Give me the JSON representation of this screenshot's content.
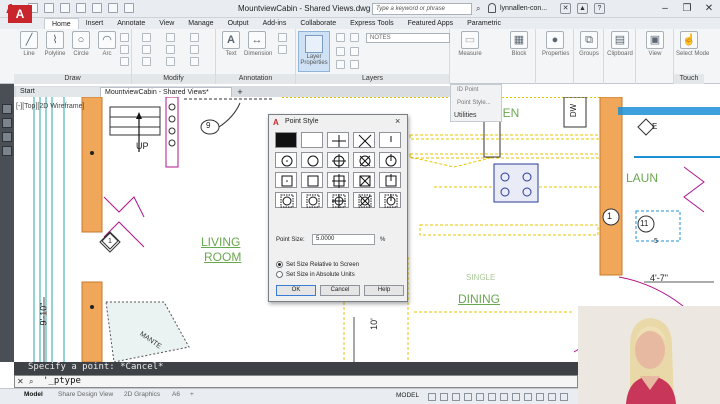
{
  "window": {
    "title": "MountviewCabin - Shared Views.dwg",
    "search_placeholder": "Type a keyword or phrase",
    "username": "lynnallen-con..."
  },
  "app_button": "A",
  "ribbon_tabs": [
    "Home",
    "Insert",
    "Annotate",
    "View",
    "Manage",
    "Output",
    "Add-ins",
    "Collaborate",
    "Express Tools",
    "Featured Apps",
    "Parametric"
  ],
  "ribbon": {
    "draw": {
      "title": "Draw",
      "buttons": [
        "Line",
        "Polyline",
        "Circle",
        "Arc"
      ]
    },
    "modify": {
      "title": "Modify"
    },
    "annotation": {
      "title": "Annotation",
      "buttons": [
        "Text",
        "Dimension"
      ]
    },
    "layers": {
      "title": "Layers",
      "properties_label": "Layer Properties",
      "layer_dropdown": "NOTES"
    },
    "measure_label": "Measure",
    "block_label": "Block",
    "properties_label": "Properties",
    "groups_label": "Groups",
    "clipboard_label": "Clipboard",
    "view_label": "View",
    "select_mode_label": "Select Mode",
    "touch_title": "Touch"
  },
  "flyout": {
    "item1": "ID Point",
    "item2": "Point Style...",
    "utilities": "Utilities"
  },
  "doc_tabs": {
    "start": "Start",
    "active": "MountviewCabin - Shared Views*",
    "add": "+"
  },
  "viewport_label": "[-][Top][2D Wireframe]",
  "drawing": {
    "up": "UP",
    "living": "LIVING",
    "room": "ROOM",
    "kitchen_partial": "HEN",
    "dw": "DW",
    "laundry_partial": "LAUN",
    "single": "SINGLE",
    "dining": "DINING",
    "dim_4_7": "4'-7\"",
    "dim_9_10": "9'-10\"",
    "dim_10": "10'",
    "mantel_partial": "MANTE",
    "tag_9": "9",
    "tag_1": "1",
    "tag_11": "11",
    "tag_e": "E",
    "tag_5": "5"
  },
  "dialog": {
    "title": "Point Style",
    "point_size_label": "Point Size:",
    "point_size_value": "5.0000",
    "unit": "%",
    "radio_relative": "Set Size Relative to Screen",
    "radio_absolute": "Set Size in Absolute Units",
    "ok": "OK",
    "cancel": "Cancel",
    "help": "Help"
  },
  "command": {
    "history": "Specify a point: *Cancel*",
    "prompt": "'_ptype"
  },
  "status": {
    "layout_tabs": [
      "Model",
      "Share Design View",
      "2D Graphics",
      "A6"
    ],
    "model": "MODEL"
  },
  "colors": {
    "accent_red": "#c4262e",
    "wall_orange": "#f0a75a",
    "annotation_green": "#6aa84f",
    "highlight_blue": "#1c8fd6",
    "drawing_magenta": "#b0148c",
    "hatch_yellow": "#e8c400",
    "command_bg": "#3e4247"
  }
}
